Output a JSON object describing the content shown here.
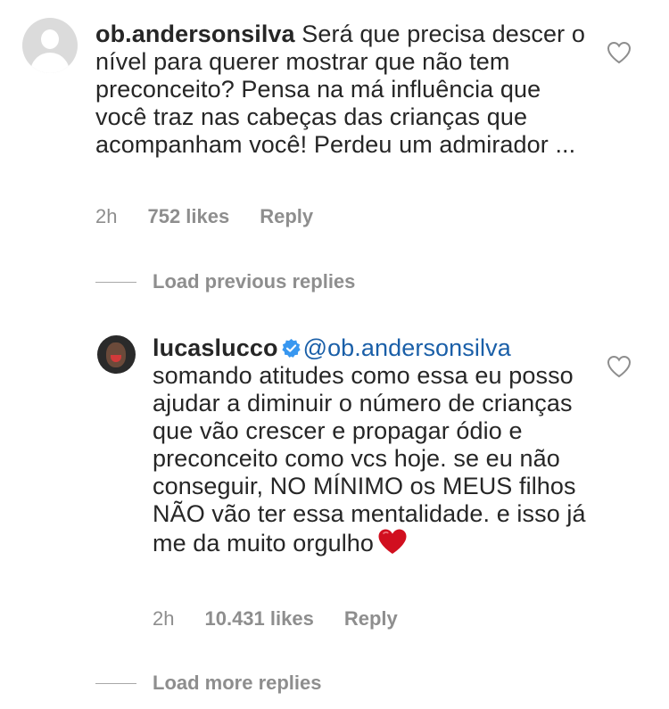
{
  "comments": [
    {
      "username": "ob.andersonsilva",
      "text": "Será que precisa descer o nível para querer mostrar que não tem preconceito? Pensa na má influência que você traz nas cabeças das crianças que acompanham você! Perdeu um admirador ...",
      "time": "2h",
      "likes": "752 likes",
      "reply": "Reply"
    },
    {
      "username": "lucaslucco",
      "verified": true,
      "mention": "@ob.andersonsilva",
      "text": "somando atitudes como essa eu posso ajudar a diminuir o número de crianças que vão crescer e propagar ódio e preconceito como vcs hoje. se eu não conseguir, NO MÍNIMO os MEUS filhos NÃO vão ter essa mentalidade. e isso já me da muito orgulho",
      "time": "2h",
      "likes": "10.431 likes",
      "reply": "Reply"
    }
  ],
  "load_previous": "Load previous replies",
  "load_more": "Load more replies",
  "colors": {
    "text": "#262626",
    "meta": "#8e8e8e",
    "mention": "#1a5fa8",
    "verified": "#3897f0",
    "heart": "#d10f1f"
  }
}
